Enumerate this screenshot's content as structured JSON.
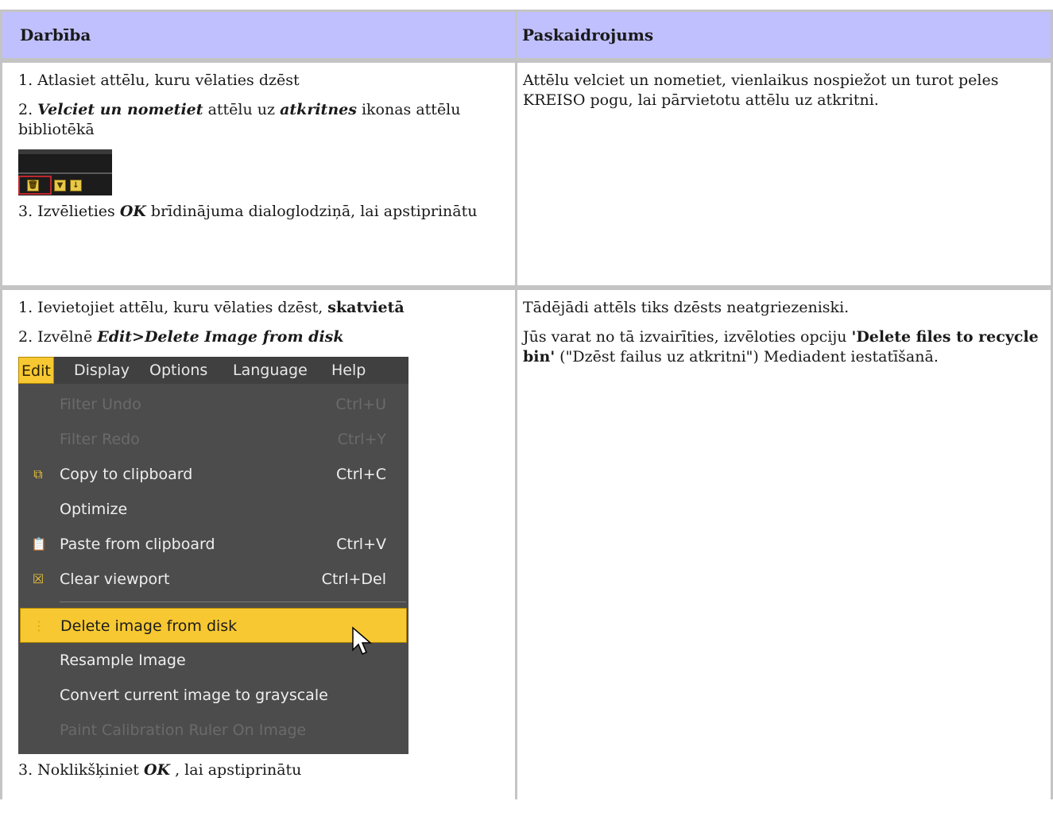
{
  "table": {
    "header": {
      "col1": "Darbība",
      "col2": "Paskaidrojums"
    },
    "row1": {
      "step1": "1. Atlasiet attēlu, kuru vēlaties dzēst",
      "step2_a": "2. ",
      "step2_b": "Velciet un nometiet",
      "step2_c": " attēlu uz ",
      "step2_d": "atkritnes",
      "step2_e": " ikonas attēlu bibliotēkā",
      "step3_a": "3. Izvēlieties ",
      "step3_b": "OK",
      "step3_c": " brīdinājuma dialoglodziņā, lai apstiprinātu",
      "explanation": "Attēlu velciet un nometiet, vienlaikus nospiežot un turot peles KREISO pogu, lai pārvietotu attēlu uz atkritni."
    },
    "row2": {
      "step1_a": "1. Ievietojiet attēlu, kuru vēlaties dzēst, ",
      "step1_b": "skatvietā",
      "step2_a": "2. Izvēlnē ",
      "step2_b": "Edit>Delete Image from disk",
      "step3_a": "3. Noklikšķiniet ",
      "step3_b": "OK",
      "step3_c": " , lai apstiprinātu",
      "expl1": "Tādējādi attēls tiks dzēsts neatgriezeniski.",
      "expl2_a": "Jūs varat no tā izvairīties, izvēloties opciju ",
      "expl2_b": "'Delete files to recycle bin'",
      "expl2_c": " (\"Dzēst failus uz atkritni\") Mediadent iestatīšanā."
    }
  },
  "icon_strip": {
    "icons": [
      "trash-icon",
      "filter-icon",
      "download-icon"
    ],
    "colors": {
      "icon": "#e7c948",
      "selection": "#c0282d",
      "background": "#1c1c1c"
    }
  },
  "menu": {
    "menubar": [
      "Edit",
      "Display",
      "Options",
      "Language",
      "Help"
    ],
    "items": [
      {
        "label": "Filter Undo",
        "shortcut": "Ctrl+U",
        "disabled": true
      },
      {
        "label": "Filter Redo",
        "shortcut": "Ctrl+Y",
        "disabled": true
      },
      {
        "label": "Copy to clipboard",
        "shortcut": "Ctrl+C",
        "icon": "copy-icon"
      },
      {
        "label": "Optimize",
        "shortcut": ""
      },
      {
        "label": "Paste from clipboard",
        "shortcut": "Ctrl+V",
        "icon": "paste-icon"
      },
      {
        "label": "Clear viewport",
        "shortcut": "Ctrl+Del",
        "icon": "clear-icon"
      },
      {
        "label": "Delete image from disk",
        "shortcut": "",
        "highlighted": true
      },
      {
        "label": "Resample Image",
        "shortcut": ""
      },
      {
        "label": "Convert current image to grayscale",
        "shortcut": ""
      },
      {
        "label": "Paint Calibration Ruler On Image",
        "shortcut": "",
        "disabled": true
      }
    ],
    "colors": {
      "background": "#4c4c4c",
      "highlight": "#f7c831",
      "text": "#efefef",
      "disabled": "#6a6a6a"
    }
  }
}
